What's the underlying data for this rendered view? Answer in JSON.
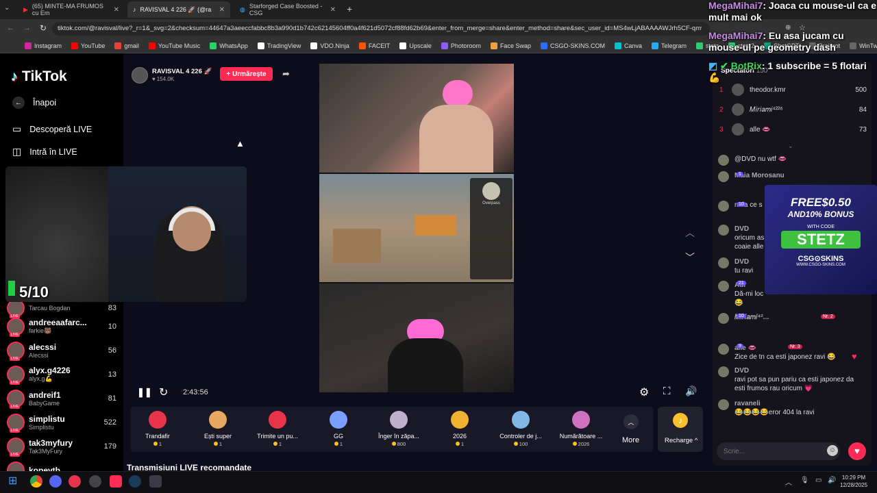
{
  "browser": {
    "tabs": [
      {
        "label": "(65) MINTE-MA FRUMOS cu Em",
        "active": false
      },
      {
        "label": "RAVISVAL 4 226 🚀 (@ra",
        "active": true
      },
      {
        "label": "Starforged Case Boosted - CSG",
        "active": false
      }
    ],
    "url": "tiktok.com/@ravisval/live?_r=1&_svg=2&checksum=44647a3aeeccfabbc8b3a990d1b742c62145604ff0a4f621d5072cf88fd62b69&enter_from_merge=share&enter_method=share&sec_user_id=MS4wLjABAAAAWJrh5CF-qmvfXaw01FSrRqmbTjGtHGfu",
    "bookmarks": [
      "Instagram",
      "YouTube",
      "gmail",
      "YouTube Music",
      "WhatsApp",
      "TradingView",
      "VDO.Ninja",
      "FACEIT",
      "Upscale",
      "Photoroom",
      "Face Swap",
      "CSGO-SKINS.COM",
      "Canva",
      "Telegram",
      "stetz",
      "stetz2",
      "ChatGPT",
      "Brainrot",
      "WinTweaker"
    ],
    "bookmark_colors": [
      "#d6249f",
      "#ff0000",
      "#ea4335",
      "#ff0000",
      "#25d366",
      "#ffffff",
      "#ffffff",
      "#ff5500",
      "#ffffff",
      "#8b5cf6",
      "#f0a040",
      "#2b6cff",
      "#00c4cc",
      "#2aabee",
      "#2ecc71",
      "#2ecc71",
      "#10a37f",
      "#666666",
      "#666666"
    ]
  },
  "sidebar": {
    "logo": "TikTok",
    "back": "Înapoi",
    "discover": "Descoperă LIVE",
    "go_live": "Intră în LIVE",
    "accounts": [
      {
        "name": "",
        "sub": "Tarcau Bogdan",
        "count": "83"
      },
      {
        "name": "andreeaafarc...",
        "sub": "farkie🐻",
        "count": "10"
      },
      {
        "name": "alecssi",
        "sub": "Alecssi",
        "count": "56"
      },
      {
        "name": "alyx.g4226",
        "sub": "alyx.g💪",
        "count": "13"
      },
      {
        "name": "andreif1",
        "sub": "BabyGame",
        "count": "81"
      },
      {
        "name": "simplistu",
        "sub": "Simplistu",
        "count": "522"
      },
      {
        "name": "tak3myfury",
        "sub": "Tak3MyFury",
        "count": "179"
      },
      {
        "name": "kopevtb",
        "sub": "",
        "count": ""
      }
    ],
    "live_badge": "LIVE"
  },
  "stream": {
    "host": "RAVISVAL 4 226 🚀",
    "likes": "154.0K",
    "follow": "+ Urmărește",
    "time": "2:43:56",
    "counter": "5/10",
    "game_map": "Overpass",
    "recommended": "Transmisiuni LIVE recomandate"
  },
  "gifts": [
    {
      "name": "Trandafir",
      "cost": "1",
      "color": "#e8344a"
    },
    {
      "name": "Ești super",
      "cost": "1",
      "color": "#e8a860"
    },
    {
      "name": "Trimite un pu...",
      "cost": "1",
      "color": "#e8344a"
    },
    {
      "name": "GG",
      "cost": "1",
      "color": "#7aa0ff"
    },
    {
      "name": "Înger în zăpa...",
      "cost": "800",
      "color": "#c0b0d0"
    },
    {
      "name": "2026",
      "cost": "1",
      "color": "#f0b030"
    },
    {
      "name": "Controler de j...",
      "cost": "100",
      "color": "#7fb8e8"
    },
    {
      "name": "Numărătoare ...",
      "cost": "2026",
      "color": "#d070c0"
    }
  ],
  "gift_more": "More",
  "recharge": "Recharge ^",
  "viewers": {
    "label": "Spectatori",
    "count": "150",
    "top": [
      {
        "rank": "1",
        "name": "theodor.kmr",
        "score": "500"
      },
      {
        "rank": "2",
        "name": "𝑀𝑖𝑟𝑖𝑎𝑚𝑖⁴²²⁶",
        "score": "84"
      },
      {
        "rank": "3",
        "name": "alle 👄",
        "score": "73"
      }
    ]
  },
  "chat": [
    {
      "user": "",
      "text": "@DVD nu wtf 👄"
    },
    {
      "user": "Maia Morosanu",
      "text": ""
    },
    {
      "user": "",
      "text": "mda ce s"
    },
    {
      "user": "DVD",
      "text": "oricum as coaie alle"
    },
    {
      "user": "DVD",
      "text": "tu ravi"
    },
    {
      "user": "Adr",
      "text": "Dă-mi loc 😂"
    },
    {
      "user": "𝑀𝑖𝑟𝑖𝑎𝑚𝑖⁴²...",
      "text": ""
    },
    {
      "user": "alle 👄",
      "text": "Zice de tn ca esti japonez ravi 😂"
    },
    {
      "user": "DVD",
      "text": "ravi pot sa pun pariu ca esti japonez da esti frumos rau oricum 💗"
    },
    {
      "user": "ravaneli",
      "text": "😂😂😂😂eror 404 la ravi"
    }
  ],
  "chat_badges": [
    "1",
    "10",
    "21",
    "10",
    "9"
  ],
  "chat_rank_tags": [
    "Nr. 2",
    "Nr. 3"
  ],
  "chat_input_placeholder": "Scrie...",
  "ad": {
    "line1": "FREE$0.50",
    "line2": "AND10% BONUS",
    "with_code": "WITH CODE",
    "code": "STETZ",
    "brand": "CSG⊙SKINS",
    "site": "WWW.CSGO-SKINS.COM"
  },
  "overlay_chat": [
    {
      "user": "MegaMihai7",
      "text": ": Joaca cu mouse-ul ca e mult mai ok"
    },
    {
      "user": "MegaMihai7",
      "text": ": Eu asa jucam cu mouse-ul pe geometry dash"
    },
    {
      "user": "BotRix",
      "text": ": 1 subscribe = 5 flotari💪"
    }
  ],
  "clock": {
    "time": "10:29 PM",
    "date": "12/28/2025"
  }
}
